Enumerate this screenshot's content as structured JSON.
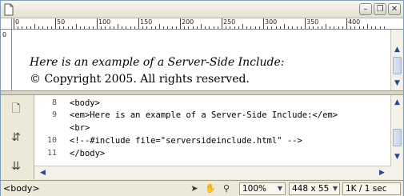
{
  "title_bar": {
    "window_buttons": [
      "minimize",
      "restore",
      "close"
    ]
  },
  "ruler": {
    "ticks": [
      "0",
      "50",
      "100",
      "150",
      "200",
      "250",
      "300",
      "350",
      "400"
    ],
    "vertical_tick": "0"
  },
  "design_view": {
    "line1": "Here is an example of a Server-Side Include:",
    "line2": "© Copyright 2005. All rights reserved."
  },
  "code_view": {
    "lines": [
      {
        "num": "8",
        "text": "<body>"
      },
      {
        "num": "9",
        "text": "<em>Here is an example of a Server-Side Include:</em>"
      },
      {
        "num": "",
        "text": "<br>"
      },
      {
        "num": "10",
        "text": "<!--#include file=\"serversideinclude.html\" -->"
      },
      {
        "num": "11",
        "text": "</body>"
      }
    ],
    "toolbar_icons": [
      "page-icon",
      "expand-icon",
      "collapse-icon"
    ]
  },
  "status_bar": {
    "tag_selector": "<body>",
    "zoom": "100%",
    "dimensions": "448 x 55",
    "download": "1K / 1 sec"
  }
}
